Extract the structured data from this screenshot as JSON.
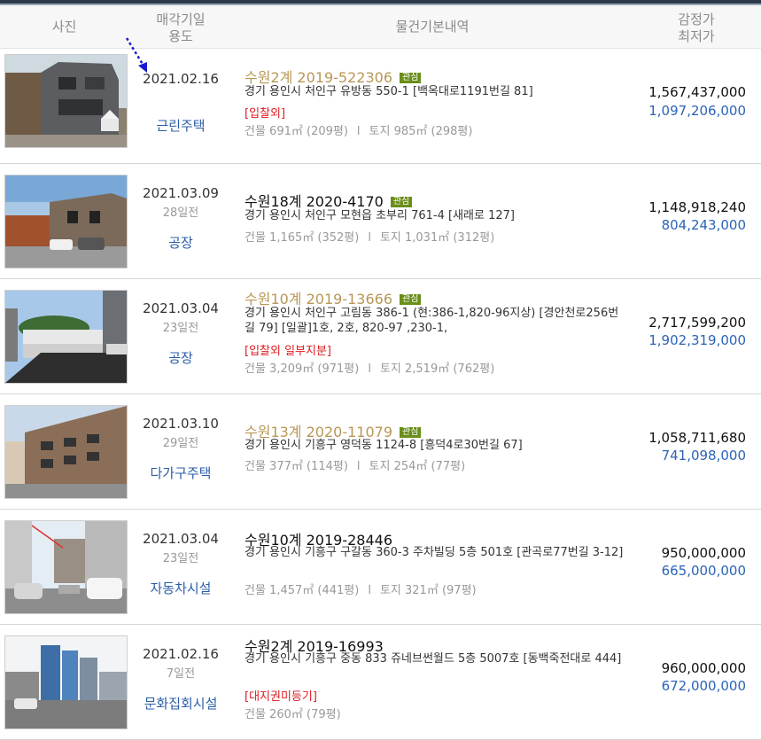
{
  "header": {
    "photo": "사진",
    "date_line1": "매각기일",
    "date_line2": "용도",
    "info": "물건기본내역",
    "price_line1": "감정가",
    "price_line2": "최저가"
  },
  "interest_label": "관심",
  "area_separator": "l",
  "items": [
    {
      "date": "2021.02.16",
      "days": "",
      "use": "근린주택",
      "case": "수원2계 2019-522306",
      "addr": "경기 용인시 처인구 유방동 550-1 [백옥대로1191번길 81]",
      "flag": "[입찰외]",
      "building": "건물 691㎡ (209평)",
      "land": "토지 985㎡ (298평)",
      "appraisal": "1,567,437,000",
      "minimum": "1,097,206,000"
    },
    {
      "date": "2021.03.09",
      "days": "28일전",
      "use": "공장",
      "case": "수원18계 2020-4170",
      "addr": "경기 용인시 처인구 모현읍 초부리 761-4 [새래로 127]",
      "flag": "",
      "building": "건물 1,165㎡ (352평)",
      "land": "토지 1,031㎡ (312평)",
      "appraisal": "1,148,918,240",
      "minimum": "804,243,000"
    },
    {
      "date": "2021.03.04",
      "days": "23일전",
      "use": "공장",
      "case": "수원10계 2019-13666",
      "addr": "경기 용인시 처인구 고림동 386-1 (현:386-1,820-96지상) [경안천로256번길 79] [일괄]1호, 2호, 820-97 ,230-1,",
      "flag": "[입찰외   일부지분]",
      "building": "건물 3,209㎡ (971평)",
      "land": "토지 2,519㎡ (762평)",
      "appraisal": "2,717,599,200",
      "minimum": "1,902,319,000"
    },
    {
      "date": "2021.03.10",
      "days": "29일전",
      "use": "다가구주택",
      "case": "수원13계 2020-11079",
      "addr": "경기 용인시 기흥구 영덕동 1124-8 [흥덕4로30번길 67]",
      "flag": "",
      "building": "건물 377㎡ (114평)",
      "land": "토지 254㎡ (77평)",
      "appraisal": "1,058,711,680",
      "minimum": "741,098,000"
    },
    {
      "date": "2021.03.04",
      "days": "23일전",
      "use": "자동차시설",
      "case": "수원10계 2019-28446",
      "addr": "경기 용인시 기흥구 구갈동 360-3 주차빌딩 5층 501호 [관곡로77번길 3-12]",
      "flag": "",
      "building": "건물 1,457㎡ (441평)",
      "land": "토지 321㎡ (97평)",
      "appraisal": "950,000,000",
      "minimum": "665,000,000"
    },
    {
      "date": "2021.02.16",
      "days": "7일전",
      "use": "문화집회시설",
      "case": "수원2계 2019-16993",
      "addr": "경기 용인시 기흥구 중동 833 쥬네브썬월드 5층 5007호 [동백죽전대로 444]",
      "flag": "[대지권미등기]",
      "building": "건물 260㎡ (79평)",
      "land": "",
      "appraisal": "960,000,000",
      "minimum": "672,000,000"
    }
  ]
}
